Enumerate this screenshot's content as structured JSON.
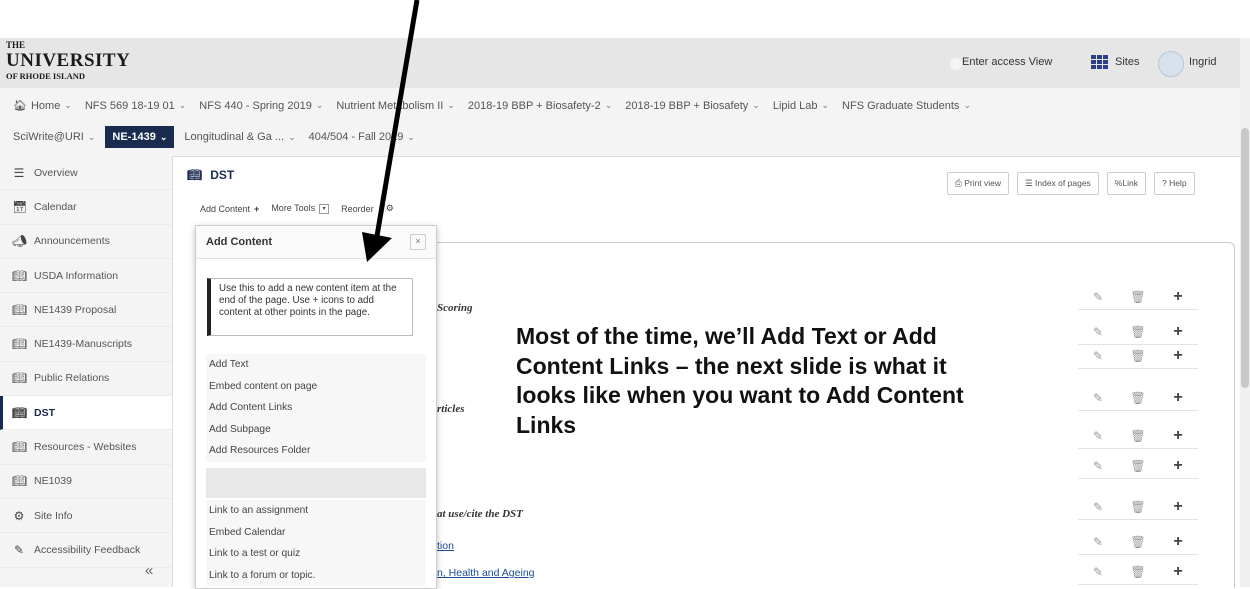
{
  "header": {
    "logo": {
      "line1": "THE",
      "line2": "UNIVERSITY",
      "line3": "OF RHODE ISLAND"
    },
    "access_view": "Enter access View",
    "sites_label": "Sites",
    "user_name": "Ingrid"
  },
  "nav": {
    "row1": [
      {
        "label": "Home",
        "icon": "home-icon"
      },
      {
        "label": "NFS 569 18-19 01"
      },
      {
        "label": "NFS 440 - Spring 2019"
      },
      {
        "label": "Nutrient Metabolism II"
      },
      {
        "label": "2018-19 BBP + Biosafety-2"
      },
      {
        "label": "2018-19 BBP + Biosafety"
      },
      {
        "label": "Lipid Lab"
      },
      {
        "label": "NFS Graduate Students"
      }
    ],
    "row2": [
      {
        "label": "SciWrite@URI"
      },
      {
        "label": "NE-1439",
        "active": true
      },
      {
        "label": "Longitudinal & Ga ..."
      },
      {
        "label": "404/504 - Fall 2019"
      }
    ]
  },
  "sidebar": {
    "items": [
      {
        "label": "Overview",
        "icon": "list-icon"
      },
      {
        "label": "Calendar",
        "icon": "calendar-icon"
      },
      {
        "label": "Announcements",
        "icon": "megaphone-icon"
      },
      {
        "label": "USDA Information",
        "icon": "book-icon"
      },
      {
        "label": "NE1439 Proposal",
        "icon": "book-icon"
      },
      {
        "label": "NE1439-Manuscripts",
        "icon": "book-icon"
      },
      {
        "label": "Public Relations",
        "icon": "book-icon"
      },
      {
        "label": "DST",
        "icon": "book-icon",
        "current": true
      },
      {
        "label": "Resources - Websites",
        "icon": "book-icon"
      },
      {
        "label": "NE1039",
        "icon": "book-icon"
      },
      {
        "label": "Site Info",
        "icon": "gear-icon"
      },
      {
        "label": "Accessibility Feedback",
        "icon": "accessibility-icon"
      }
    ],
    "collapse_glyph": "«"
  },
  "page": {
    "title": "DST",
    "toolbar": {
      "add_content": "Add Content",
      "more_tools": "More Tools",
      "reorder": "Reorder"
    },
    "buttons": {
      "print": "Print view",
      "index": "Index of pages",
      "link": "Link",
      "help": "Help"
    }
  },
  "content": {
    "scoring": "Scoring",
    "articles": "rticles",
    "use_cite": "at use/cite the DST",
    "link1": "tion",
    "link2": "n, Health and Ageing"
  },
  "dropdown": {
    "title": "Add Content",
    "close": "×",
    "help_text": "Use this to add a new content item at the end of the page. Use + icons to add content at other points in the page.",
    "group1": [
      "Add Text",
      "Embed content on page",
      "Add Content Links",
      "Add Subpage",
      "Add Resources Folder"
    ],
    "group2": [
      "Link to an assignment",
      "Embed Calendar",
      "Link to a test or quiz",
      "Link to a forum or topic."
    ]
  },
  "annotation": "Most of the time, we’ll Add Text or Add Content Links – the next slide is what it looks like when you want to Add Content Links",
  "colors": {
    "brand_dark": "#1a2b50",
    "link": "#1a4c9a",
    "sites_icon": "#2c3e8a"
  }
}
